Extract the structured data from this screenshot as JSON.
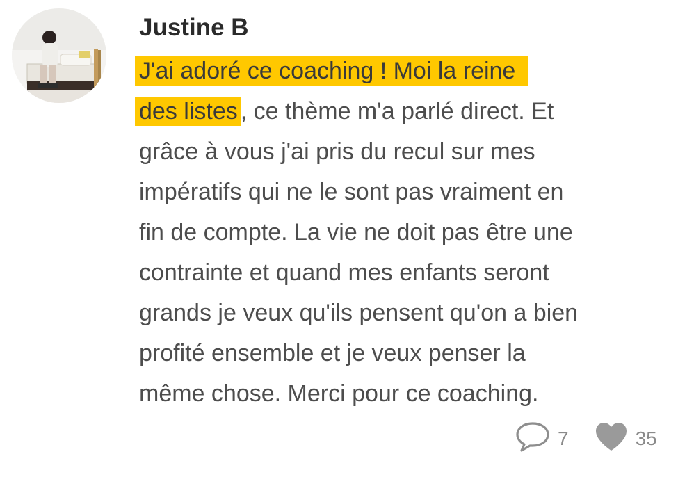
{
  "comment": {
    "author": "Justine B",
    "highlighted_lines": [
      "J'ai adoré ce coaching ! Moi la reine",
      "des listes"
    ],
    "line2_rest": ", ce thème m'a parlé direct. Et",
    "lines": [
      "grâce à vous j'ai pris du recul sur mes",
      "impératifs qui ne le sont pas vraiment en",
      "fin de compte. La vie ne doit pas être une",
      "contrainte et quand mes enfants seront",
      "grands je veux qu'ils pensent qu'on a bien",
      "profité ensemble et je veux penser la",
      "même chose. Merci pour ce coaching."
    ],
    "highlight_color": "#ffc800",
    "reply_count": "7",
    "like_count": "35",
    "icons": {
      "reply": "speech-bubble-icon",
      "like": "heart-icon"
    }
  }
}
